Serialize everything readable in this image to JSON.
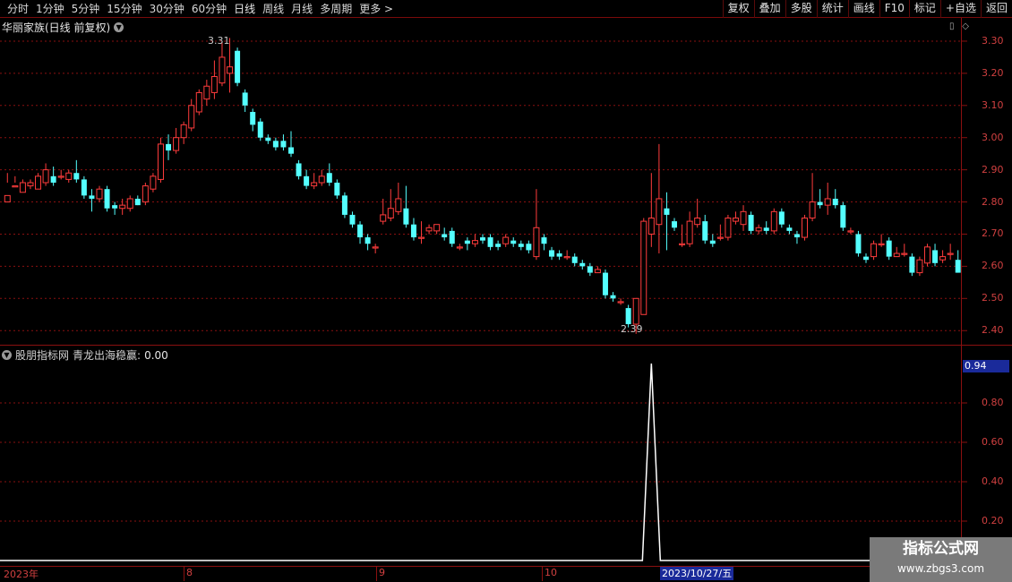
{
  "toolbar": {
    "periods": [
      "分时",
      "1分钟",
      "5分钟",
      "15分钟",
      "30分钟",
      "60分钟",
      "日线",
      "周线",
      "月线",
      "多周期",
      "更多 >"
    ],
    "active_period": "日线",
    "right_tools": [
      "复权",
      "叠加",
      "多股",
      "统计",
      "画线",
      "F10",
      "标记",
      "+自选",
      "返回"
    ]
  },
  "price_panel": {
    "title": "华丽家族(日线 前复权)",
    "high_label": "3.31",
    "low_label": "2.39",
    "axis_labels": [
      "3.30",
      "3.20",
      "3.10",
      "3.00",
      "2.90",
      "2.80",
      "2.70",
      "2.60",
      "2.50",
      "2.40"
    ]
  },
  "indicator_panel": {
    "name": "股朋指标网",
    "formula_label": "青龙出海稳赢:",
    "formula_value": "0.00",
    "current_value": "0.94",
    "axis_labels": [
      "0.80",
      "0.60",
      "0.40",
      "0.20"
    ]
  },
  "date_axis": {
    "labels": [
      "2023年",
      "8",
      "9",
      "10"
    ],
    "cursor_date": "2023/10/27/五"
  },
  "watermark": {
    "title": "指标公式网",
    "url": "www.zbgs3.com"
  },
  "colors": {
    "up": "#ff3c3c",
    "down": "#54ffff",
    "grid": "#8a1010",
    "cursor_bg": "#1a2a9a"
  },
  "chart_data": {
    "type": "candlestick",
    "ylim": [
      2.37,
      3.35
    ],
    "ohlc": [
      [
        2.8,
        2.82,
        2.86,
        2.89
      ],
      [
        2.85,
        2.85,
        2.86,
        2.88
      ],
      [
        2.83,
        2.86,
        2.83,
        2.87
      ],
      [
        2.85,
        2.86,
        2.84,
        2.87
      ],
      [
        2.84,
        2.88,
        2.84,
        2.89
      ],
      [
        2.86,
        2.9,
        2.85,
        2.92
      ],
      [
        2.88,
        2.86,
        2.85,
        2.91
      ],
      [
        2.88,
        2.88,
        2.87,
        2.9
      ],
      [
        2.87,
        2.89,
        2.86,
        2.9
      ],
      [
        2.89,
        2.87,
        2.86,
        2.93
      ],
      [
        2.87,
        2.82,
        2.81,
        2.88
      ],
      [
        2.82,
        2.81,
        2.77,
        2.84
      ],
      [
        2.81,
        2.84,
        2.8,
        2.85
      ],
      [
        2.84,
        2.78,
        2.77,
        2.85
      ],
      [
        2.79,
        2.78,
        2.76,
        2.8
      ],
      [
        2.78,
        2.79,
        2.76,
        2.81
      ],
      [
        2.78,
        2.81,
        2.77,
        2.82
      ],
      [
        2.81,
        2.79,
        2.79,
        2.82
      ],
      [
        2.8,
        2.85,
        2.79,
        2.86
      ],
      [
        2.84,
        2.88,
        2.83,
        2.89
      ],
      [
        2.87,
        2.98,
        2.86,
        3.0
      ],
      [
        2.98,
        2.96,
        2.93,
        3.01
      ],
      [
        2.96,
        3.0,
        2.95,
        3.03
      ],
      [
        3.0,
        3.04,
        2.98,
        3.05
      ],
      [
        3.03,
        3.1,
        3.02,
        3.12
      ],
      [
        3.08,
        3.14,
        3.07,
        3.15
      ],
      [
        3.12,
        3.16,
        3.1,
        3.18
      ],
      [
        3.14,
        3.19,
        3.12,
        3.24
      ],
      [
        3.17,
        3.25,
        3.16,
        3.3
      ],
      [
        3.2,
        3.22,
        3.14,
        3.31
      ],
      [
        3.27,
        3.17,
        3.16,
        3.28
      ],
      [
        3.14,
        3.1,
        3.08,
        3.15
      ],
      [
        3.08,
        3.04,
        3.02,
        3.09
      ],
      [
        3.05,
        3.0,
        2.99,
        3.06
      ],
      [
        3.0,
        2.99,
        2.98,
        3.01
      ],
      [
        2.99,
        2.97,
        2.96,
        3.0
      ],
      [
        2.99,
        2.97,
        2.96,
        3.01
      ],
      [
        2.97,
        2.95,
        2.94,
        3.02
      ],
      [
        2.92,
        2.88,
        2.87,
        2.93
      ],
      [
        2.88,
        2.85,
        2.84,
        2.9
      ],
      [
        2.85,
        2.86,
        2.84,
        2.89
      ],
      [
        2.86,
        2.88,
        2.85,
        2.9
      ],
      [
        2.89,
        2.86,
        2.85,
        2.92
      ],
      [
        2.86,
        2.82,
        2.81,
        2.87
      ],
      [
        2.82,
        2.76,
        2.75,
        2.83
      ],
      [
        2.76,
        2.73,
        2.72,
        2.77
      ],
      [
        2.73,
        2.69,
        2.67,
        2.74
      ],
      [
        2.69,
        2.67,
        2.65,
        2.7
      ],
      [
        2.66,
        2.66,
        2.64,
        2.67
      ],
      [
        2.74,
        2.76,
        2.73,
        2.81
      ],
      [
        2.75,
        2.78,
        2.74,
        2.84
      ],
      [
        2.77,
        2.81,
        2.76,
        2.86
      ],
      [
        2.78,
        2.73,
        2.72,
        2.85
      ],
      [
        2.73,
        2.69,
        2.68,
        2.75
      ],
      [
        2.69,
        2.69,
        2.67,
        2.74
      ],
      [
        2.71,
        2.72,
        2.7,
        2.73
      ],
      [
        2.71,
        2.73,
        2.7,
        2.73
      ],
      [
        2.7,
        2.69,
        2.68,
        2.72
      ],
      [
        2.71,
        2.67,
        2.66,
        2.72
      ],
      [
        2.66,
        2.66,
        2.65,
        2.67
      ],
      [
        2.68,
        2.67,
        2.65,
        2.69
      ],
      [
        2.67,
        2.68,
        2.66,
        2.7
      ],
      [
        2.69,
        2.68,
        2.67,
        2.7
      ],
      [
        2.69,
        2.66,
        2.65,
        2.7
      ],
      [
        2.67,
        2.66,
        2.65,
        2.68
      ],
      [
        2.67,
        2.69,
        2.66,
        2.7
      ],
      [
        2.68,
        2.67,
        2.66,
        2.69
      ],
      [
        2.67,
        2.66,
        2.65,
        2.68
      ],
      [
        2.67,
        2.65,
        2.64,
        2.68
      ],
      [
        2.63,
        2.72,
        2.62,
        2.84
      ],
      [
        2.69,
        2.67,
        2.65,
        2.7
      ],
      [
        2.65,
        2.63,
        2.62,
        2.66
      ],
      [
        2.64,
        2.63,
        2.62,
        2.65
      ],
      [
        2.63,
        2.63,
        2.62,
        2.65
      ],
      [
        2.63,
        2.61,
        2.6,
        2.64
      ],
      [
        2.61,
        2.6,
        2.59,
        2.62
      ],
      [
        2.6,
        2.58,
        2.57,
        2.61
      ],
      [
        2.58,
        2.59,
        2.58,
        2.6
      ],
      [
        2.58,
        2.51,
        2.5,
        2.59
      ],
      [
        2.51,
        2.5,
        2.49,
        2.52
      ],
      [
        2.49,
        2.49,
        2.48,
        2.5
      ],
      [
        2.47,
        2.42,
        2.41,
        2.48
      ],
      [
        2.42,
        2.5,
        2.39,
        2.5
      ],
      [
        2.45,
        2.74,
        2.45,
        2.75
      ],
      [
        2.7,
        2.75,
        2.66,
        2.89
      ],
      [
        2.73,
        2.81,
        2.64,
        2.98
      ],
      [
        2.78,
        2.76,
        2.65,
        2.83
      ],
      [
        2.74,
        2.72,
        2.71,
        2.75
      ],
      [
        2.67,
        2.67,
        2.66,
        2.73
      ],
      [
        2.67,
        2.74,
        2.66,
        2.77
      ],
      [
        2.73,
        2.75,
        2.72,
        2.81
      ],
      [
        2.74,
        2.68,
        2.67,
        2.76
      ],
      [
        2.68,
        2.67,
        2.66,
        2.7
      ],
      [
        2.69,
        2.69,
        2.68,
        2.73
      ],
      [
        2.69,
        2.75,
        2.68,
        2.76
      ],
      [
        2.74,
        2.75,
        2.73,
        2.77
      ],
      [
        2.73,
        2.77,
        2.71,
        2.79
      ],
      [
        2.76,
        2.71,
        2.7,
        2.77
      ],
      [
        2.71,
        2.72,
        2.7,
        2.73
      ],
      [
        2.72,
        2.71,
        2.7,
        2.74
      ],
      [
        2.71,
        2.77,
        2.7,
        2.78
      ],
      [
        2.77,
        2.73,
        2.72,
        2.78
      ],
      [
        2.72,
        2.71,
        2.7,
        2.73
      ],
      [
        2.7,
        2.69,
        2.67,
        2.71
      ],
      [
        2.69,
        2.75,
        2.68,
        2.76
      ],
      [
        2.75,
        2.8,
        2.74,
        2.89
      ],
      [
        2.8,
        2.79,
        2.78,
        2.84
      ],
      [
        2.79,
        2.81,
        2.76,
        2.86
      ],
      [
        2.81,
        2.79,
        2.78,
        2.84
      ],
      [
        2.79,
        2.72,
        2.71,
        2.8
      ],
      [
        2.71,
        2.71,
        2.7,
        2.72
      ],
      [
        2.7,
        2.64,
        2.63,
        2.71
      ],
      [
        2.63,
        2.62,
        2.61,
        2.64
      ],
      [
        2.63,
        2.67,
        2.62,
        2.68
      ],
      [
        2.67,
        2.67,
        2.66,
        2.7
      ],
      [
        2.68,
        2.63,
        2.62,
        2.69
      ],
      [
        2.63,
        2.64,
        2.63,
        2.66
      ],
      [
        2.64,
        2.64,
        2.63,
        2.67
      ],
      [
        2.63,
        2.58,
        2.57,
        2.64
      ],
      [
        2.58,
        2.62,
        2.57,
        2.63
      ],
      [
        2.61,
        2.66,
        2.6,
        2.67
      ],
      [
        2.65,
        2.61,
        2.6,
        2.67
      ],
      [
        2.62,
        2.63,
        2.61,
        2.65
      ],
      [
        2.64,
        2.64,
        2.62,
        2.67
      ],
      [
        2.62,
        2.58,
        2.58,
        2.65
      ]
    ],
    "indicator": {
      "name": "青龙出海稳赢",
      "spike_index": 84,
      "spike_value": 1.0,
      "ylim": [
        0,
        1.0
      ]
    }
  }
}
